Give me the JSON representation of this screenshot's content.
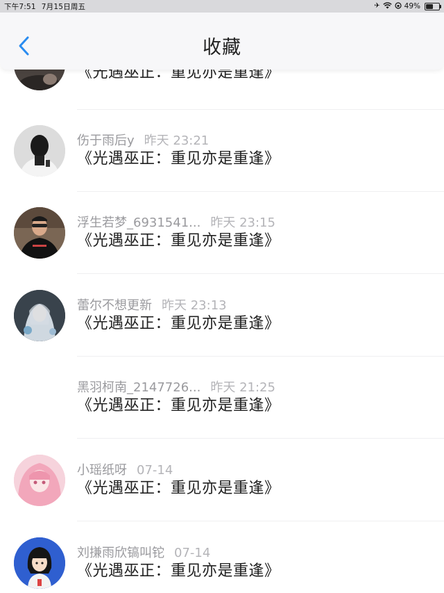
{
  "status_bar": {
    "time": "下午7:51",
    "date": "7月15日周五",
    "battery": "49%",
    "battery_level": 0.49
  },
  "header": {
    "title": "收藏"
  },
  "items": [
    {
      "name": "",
      "time": "",
      "title": "《光遇巫正：重见亦是重逢》"
    },
    {
      "name": "伤于雨后y",
      "time": "昨天 23:21",
      "title": "《光遇巫正：重见亦是重逢》"
    },
    {
      "name": "浮生若梦_6931541...",
      "time": "昨天 23:15",
      "title": "《光遇巫正：重见亦是重逢》"
    },
    {
      "name": "蕾尔不想更新",
      "time": "昨天 23:13",
      "title": "《光遇巫正：重见亦是重逢》"
    },
    {
      "name": "黑羽柯南_2147726...",
      "time": "昨天 21:25",
      "title": "《光遇巫正：重见亦是重逢》"
    },
    {
      "name": "小瑶纸呀",
      "time": "07-14",
      "title": "《光遇巫正：重见亦是重逢》"
    },
    {
      "name": "刘搛雨欣镐叫铊",
      "time": "07-14",
      "title": "《光遇巫正：重见亦是重逢》"
    }
  ]
}
